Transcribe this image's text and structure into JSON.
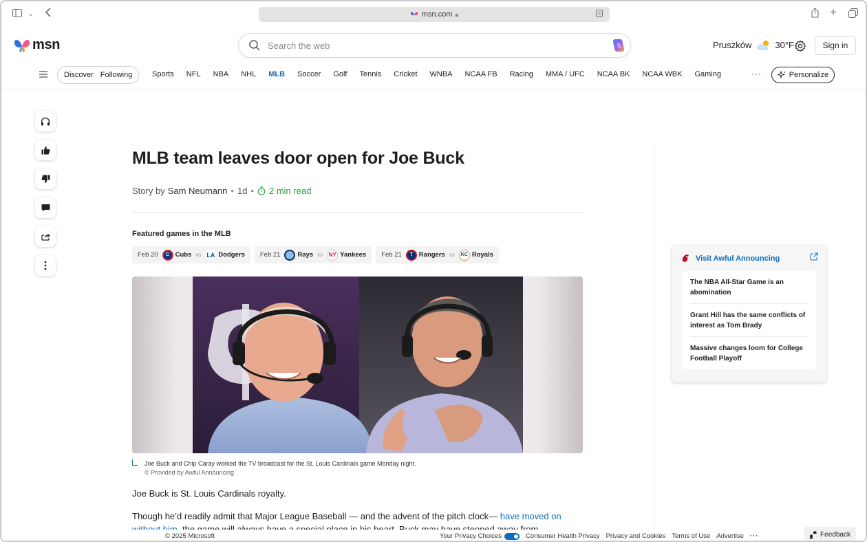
{
  "browser": {
    "url": "msn.com",
    "icons": [
      "sidebar-icon",
      "chevron-down-icon",
      "back-icon",
      "lock-icon",
      "reader-icon",
      "share-icon",
      "new-tab-icon",
      "tabs-icon"
    ]
  },
  "header": {
    "logo_text": "msn",
    "search_placeholder": "Search the web",
    "weather": {
      "city": "Pruszków",
      "temp": "30°F"
    },
    "signin_label": "Sign in"
  },
  "nav": {
    "pills": [
      "Discover",
      "Following"
    ],
    "links": [
      "Sports",
      "NFL",
      "NBA",
      "NHL",
      "MLB",
      "Soccer",
      "Golf",
      "Tennis",
      "Cricket",
      "WNBA",
      "NCAA FB",
      "Racing",
      "MMA / UFC",
      "NCAA BK",
      "NCAA WBK",
      "Gaming"
    ],
    "active": "MLB",
    "more": "···",
    "personalize_label": "Personalize"
  },
  "rail": [
    "headphones-icon",
    "thumbs-up-icon",
    "thumbs-down-icon",
    "comment-icon",
    "share-icon",
    "more-icon"
  ],
  "article": {
    "title": "MLB team leaves door open for Joe Buck",
    "story_by": "Story by",
    "author": "Sam Neumann",
    "age": "1d",
    "read_time": "2 min read",
    "featured_label": "Featured games in the MLB",
    "games": [
      {
        "date": "Feb 20",
        "home": "Cubs",
        "vs": "vs",
        "away": "Dodgers",
        "home_color": "#0e3386",
        "away_color": "#005a9c"
      },
      {
        "date": "Feb 21",
        "home": "Rays",
        "vs": "vs",
        "away": "Yankees",
        "home_color": "#092c5c",
        "away_color": "#c4ced3"
      },
      {
        "date": "Feb 21",
        "home": "Rangers",
        "vs": "vs",
        "away": "Royals",
        "home_color": "#c0111f",
        "away_color": "#004687"
      }
    ],
    "caption": "Joe Buck and Chip Caray worked the TV broadcast for the St. Louis Cardinals game Monday night.",
    "credit": "© Provided by Awful Announcing",
    "para1": "Joe Buck is St. Louis Cardinals royalty.",
    "para2_a": "Though he’d readily admit that Major League Baseball — and the advent of the pitch clock— ",
    "para2_link": "have moved on without him",
    "para2_b": ", the game will always have a special place in his heart. Buck may have stepped away from national"
  },
  "side": {
    "source_label": "Visit Awful Announcing",
    "items": [
      "The NBA All-Star Game is an abomination",
      "Grant Hill has the same conflicts of interest as Tom Brady",
      "Massive changes loom for College Football Playoff"
    ]
  },
  "footer": {
    "copyright": "© 2025 Microsoft",
    "privacy_choices": "Your Privacy Choices",
    "links": [
      "Consumer Health Privacy",
      "Privacy and Cookies",
      "Terms of Use",
      "Advertise"
    ],
    "more": "···",
    "feedback_label": "Feedback"
  },
  "colors": {
    "accent": "#0f6cbd",
    "read_time": "#2a9d3a"
  }
}
